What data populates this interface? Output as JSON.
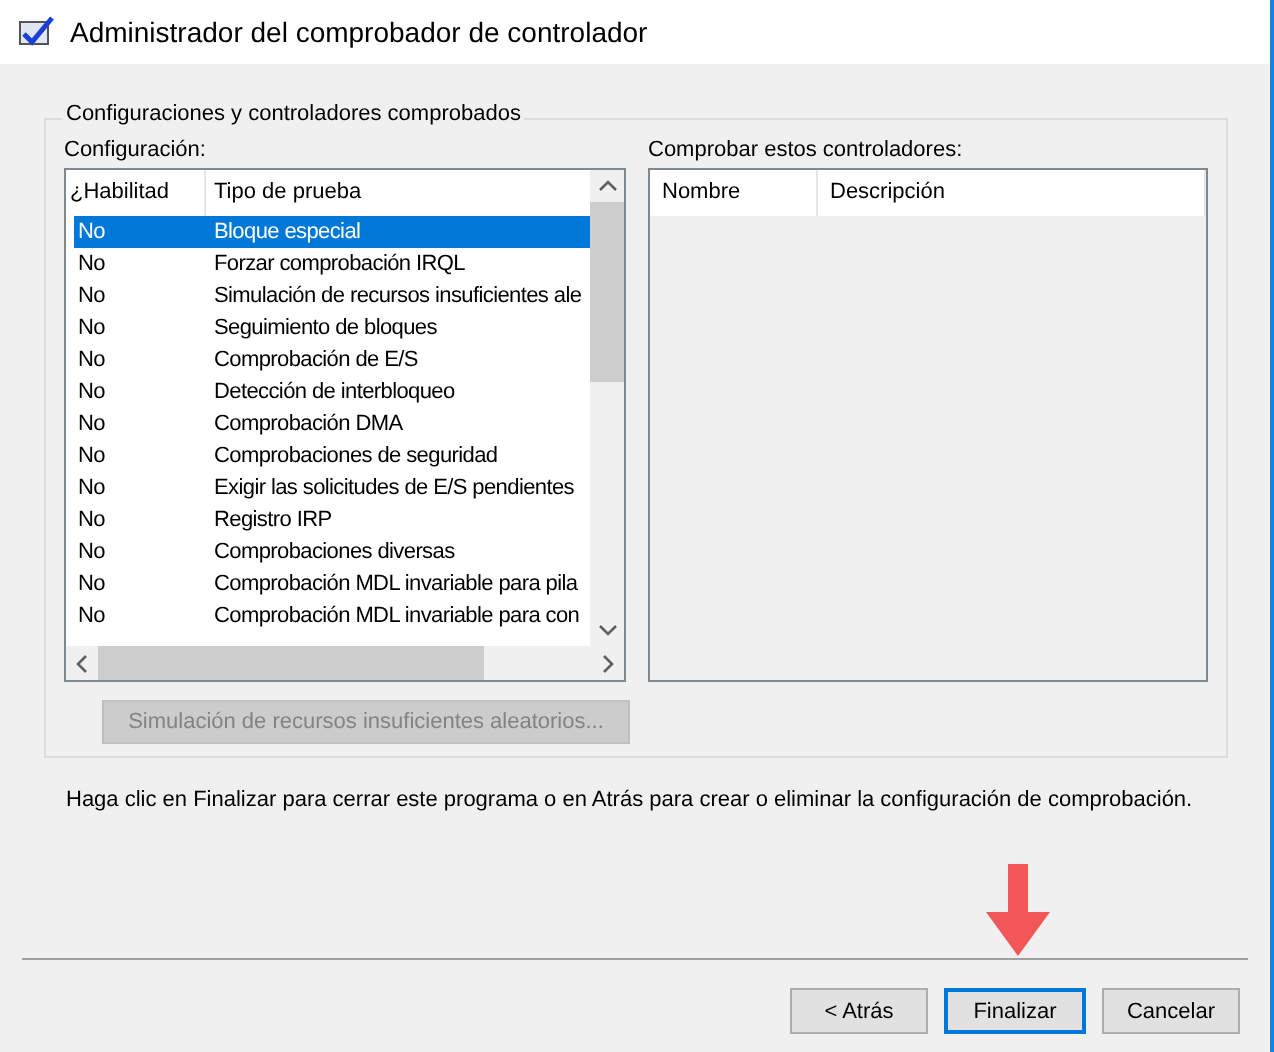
{
  "window": {
    "title": "Administrador del comprobador de controlador"
  },
  "group": {
    "title": "Configuraciones y controladores comprobados"
  },
  "configuration": {
    "label": "Configuración:",
    "columns": [
      "¿Habilitad",
      "Tipo de prueba"
    ],
    "rows": [
      {
        "enabled": "No",
        "test": "Bloque especial",
        "selected": true
      },
      {
        "enabled": "No",
        "test": "Forzar comprobación IRQL",
        "selected": false
      },
      {
        "enabled": "No",
        "test": "Simulación de recursos insuficientes ale",
        "selected": false
      },
      {
        "enabled": "No",
        "test": "Seguimiento de bloques",
        "selected": false
      },
      {
        "enabled": "No",
        "test": "Comprobación de E/S",
        "selected": false
      },
      {
        "enabled": "No",
        "test": "Detección de interbloqueo",
        "selected": false
      },
      {
        "enabled": "No",
        "test": "Comprobación DMA",
        "selected": false
      },
      {
        "enabled": "No",
        "test": "Comprobaciones de seguridad",
        "selected": false
      },
      {
        "enabled": "No",
        "test": "Exigir las solicitudes de E/S pendientes",
        "selected": false
      },
      {
        "enabled": "No",
        "test": "Registro IRP",
        "selected": false
      },
      {
        "enabled": "No",
        "test": "Comprobaciones diversas",
        "selected": false
      },
      {
        "enabled": "No",
        "test": "Comprobación MDL invariable para pila",
        "selected": false
      },
      {
        "enabled": "No",
        "test": "Comprobación MDL invariable para con",
        "selected": false
      }
    ]
  },
  "drivers": {
    "label": "Comprobar estos controladores:",
    "columns": [
      "Nombre",
      "Descripción"
    ]
  },
  "options_button": {
    "label": "Simulación de recursos insuficientes aleatorios...",
    "disabled": true
  },
  "instructions": "Haga clic en Finalizar para cerrar este programa o en Atrás para crear o eliminar la configuración de comprobación.",
  "buttons": [
    {
      "label": "< Atrás",
      "selected": false
    },
    {
      "label": "Finalizar",
      "selected": true
    },
    {
      "label": "Cancelar",
      "selected": false
    }
  ]
}
